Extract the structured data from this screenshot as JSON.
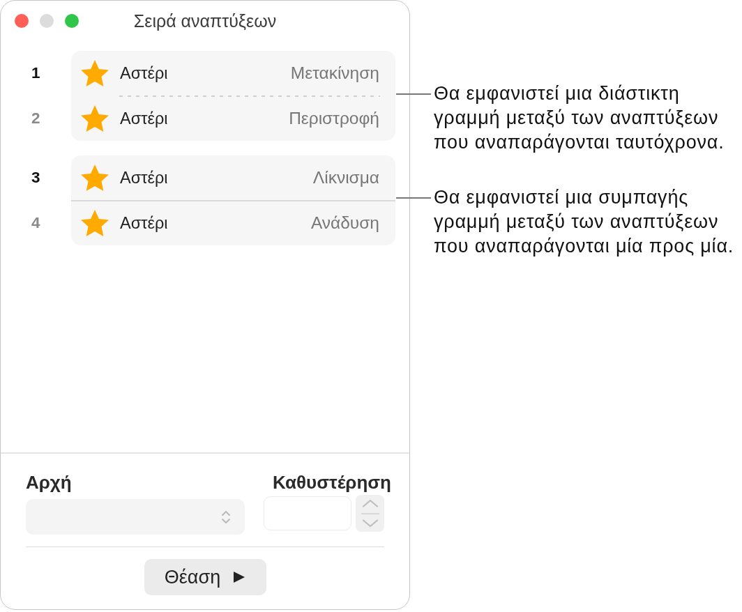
{
  "window": {
    "title": "Σειρά αναπτύξεων",
    "controls": [
      {
        "kind": "close",
        "disabled": false
      },
      {
        "kind": "minimize",
        "disabled": true
      },
      {
        "kind": "zoom",
        "disabled": false
      }
    ]
  },
  "build_groups": [
    {
      "kind": "dashed",
      "builds": [
        {
          "number": "1",
          "dimmed": false,
          "object": "Αστέρι",
          "effect": "Μετακίνηση"
        },
        {
          "number": "2",
          "dimmed": true,
          "object": "Αστέρι",
          "effect": "Περιστροφή"
        }
      ]
    },
    {
      "kind": "solid",
      "builds": [
        {
          "number": "3",
          "dimmed": false,
          "object": "Αστέρι",
          "effect": "Λίκνισμα"
        },
        {
          "number": "4",
          "dimmed": true,
          "object": "Αστέρι",
          "effect": "Ανάδυση"
        }
      ]
    }
  ],
  "start": {
    "label": "Αρχή",
    "disabled": true
  },
  "delay": {
    "label": "Καθυστέρηση",
    "disabled": true
  },
  "preview_button": {
    "label": "Θέαση"
  },
  "callouts": [
    {
      "text": "Θα εμφανιστεί μια διάστικτη γραμμή μεταξύ των αναπτύξεων που αναπαράγονται ταυτόχρονα."
    },
    {
      "text": "Θα εμφανιστεί μια συμπαγής γραμμή μεταξύ των αναπτύξεων που αναπαράγονται μία προς μία."
    }
  ]
}
